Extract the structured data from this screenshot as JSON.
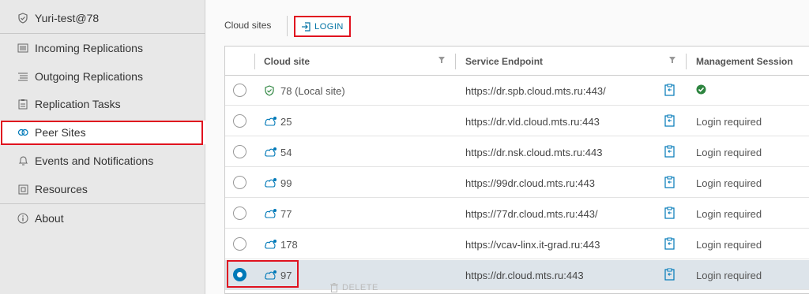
{
  "sidebar": {
    "title": "Yuri-test@78",
    "items": [
      {
        "label": "Incoming Replications",
        "icon": "list-icon"
      },
      {
        "label": "Outgoing Replications",
        "icon": "list-icon"
      },
      {
        "label": "Replication Tasks",
        "icon": "clipboard-icon"
      },
      {
        "label": "Peer Sites",
        "icon": "peer-sites-icon"
      },
      {
        "label": "Events and Notifications",
        "icon": "bell-icon"
      },
      {
        "label": "Resources",
        "icon": "resources-icon"
      },
      {
        "label": "About",
        "icon": "info-icon"
      }
    ],
    "active": "Peer Sites"
  },
  "toolbar": {
    "label": "Cloud sites",
    "login_label": "LOGIN"
  },
  "table": {
    "columns": [
      "Cloud site",
      "Service Endpoint",
      "Management Session"
    ],
    "rows": [
      {
        "site": "78 (Local site)",
        "endpoint": "https://dr.spb.cloud.mts.ru:443/",
        "session": "",
        "status": "ok",
        "selected": false
      },
      {
        "site": "25",
        "endpoint": "https://dr.vld.cloud.mts.ru:443",
        "session": "Login required",
        "selected": false
      },
      {
        "site": "54",
        "endpoint": "https://dr.nsk.cloud.mts.ru:443",
        "session": "Login required",
        "selected": false
      },
      {
        "site": "99",
        "endpoint": "https://99dr.cloud.mts.ru:443",
        "session": "Login required",
        "selected": false
      },
      {
        "site": "77",
        "endpoint": "https://77dr.cloud.mts.ru:443/",
        "session": "Login required",
        "selected": false
      },
      {
        "site": "178",
        "endpoint": "https://vcav-linx.it-grad.ru:443",
        "session": "Login required",
        "selected": false
      },
      {
        "site": "97",
        "endpoint": "https://dr.cloud.mts.ru:443",
        "session": "Login required",
        "selected": true
      }
    ]
  },
  "actions": {
    "delete_label": "DELETE"
  },
  "colors": {
    "accent": "#0079b8",
    "highlight": "#e0121f",
    "success": "#2e8540"
  }
}
